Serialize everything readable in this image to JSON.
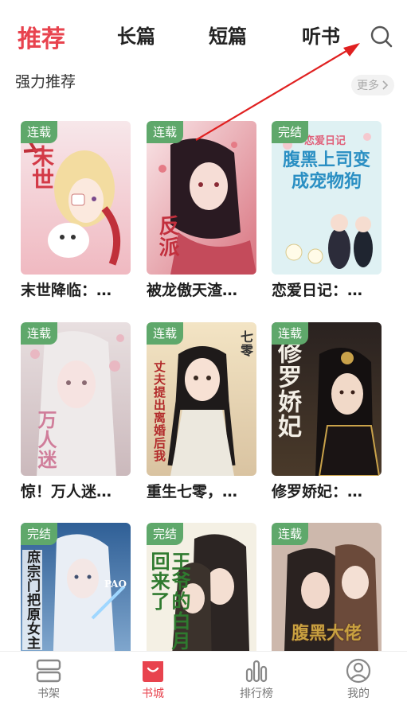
{
  "tabs": [
    {
      "label": "推荐"
    },
    {
      "label": "长篇"
    },
    {
      "label": "短篇"
    },
    {
      "label": "听书"
    }
  ],
  "section": {
    "title": "强力推荐",
    "more_label": "更多",
    "more_icon": "chevron-right-icon"
  },
  "books": [
    {
      "badge": "连载",
      "title": "末世降临：…",
      "cover_text": "末世"
    },
    {
      "badge": "连载",
      "title": "被龙傲天渣…",
      "cover_text": "反派"
    },
    {
      "badge": "完结",
      "title": "恋爱日记：…",
      "cover_text": "腹黑上司变成宠物狗",
      "cover_sub": "恋爱日记"
    },
    {
      "badge": "连载",
      "title": "惊！万人迷…",
      "cover_text": "万人迷"
    },
    {
      "badge": "连载",
      "title": "重生七零，…",
      "cover_text": "丈夫提出离婚后我",
      "cover_sub": "七零"
    },
    {
      "badge": "连载",
      "title": "修罗娇妃：…",
      "cover_text": "修罗娇妃"
    },
    {
      "badge": "完结",
      "title": "",
      "cover_text": "庶宗门把原女主",
      "cover_sub": "PAO"
    },
    {
      "badge": "完结",
      "title": "",
      "cover_text": "王爷的白月光回来了"
    },
    {
      "badge": "连载",
      "title": "",
      "cover_text": "腹黑大佬"
    }
  ],
  "nav": [
    {
      "label": "书架",
      "icon": "bookshelf-icon"
    },
    {
      "label": "书城",
      "icon": "bookstore-bag-icon"
    },
    {
      "label": "排行榜",
      "icon": "ranking-bars-icon"
    },
    {
      "label": "我的",
      "icon": "profile-icon"
    }
  ],
  "colors": {
    "accent": "#e8434e",
    "badge": "#5fa86b",
    "annotation_arrow": "#e02020"
  }
}
